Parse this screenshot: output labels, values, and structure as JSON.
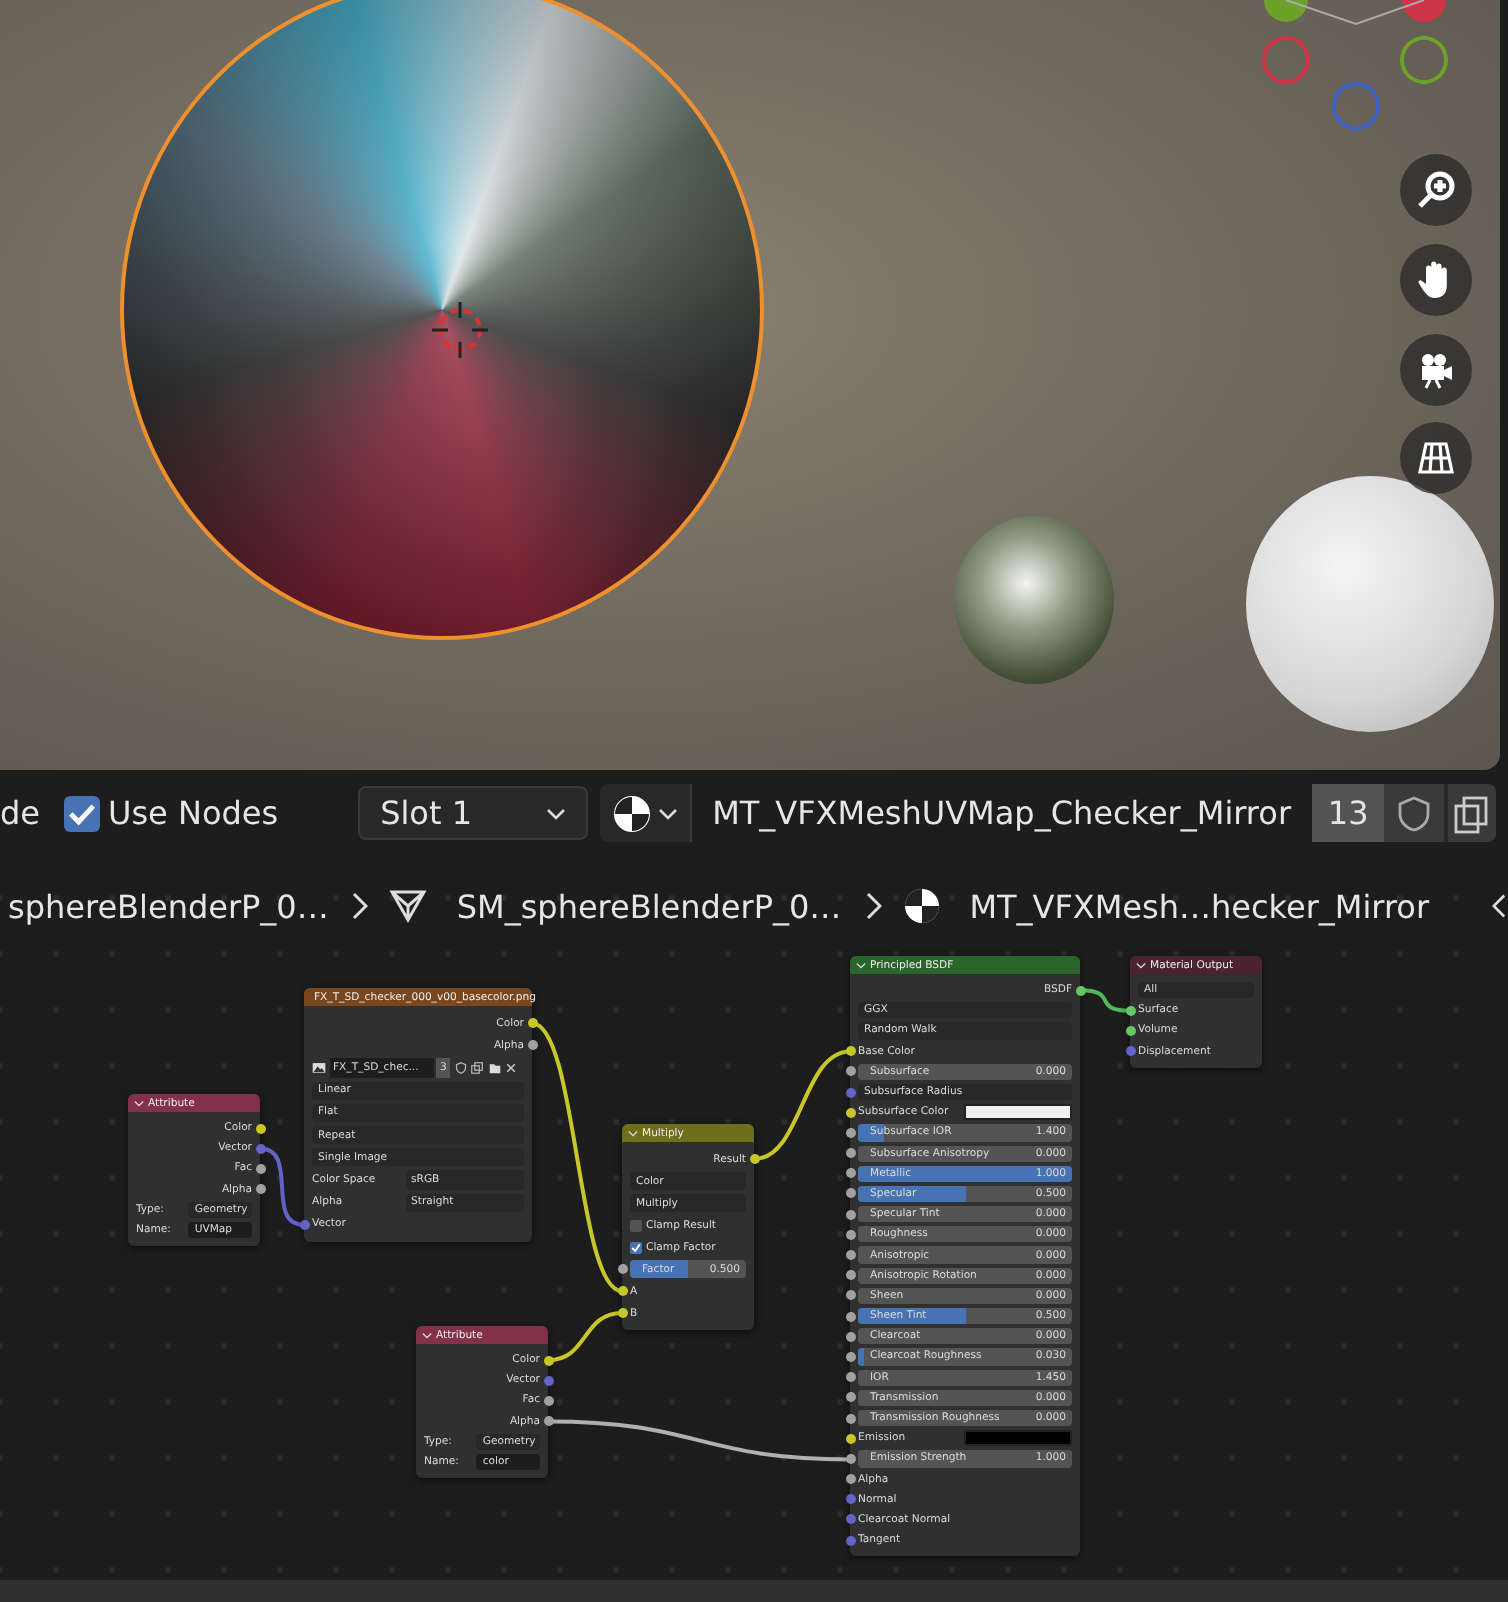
{
  "header": {
    "mode_label": "de",
    "use_nodes": {
      "label": "Use Nodes",
      "checked": true
    },
    "slot": "Slot 1",
    "material": "MT_VFXMeshUVMap_Checker_Mirror",
    "users": "13"
  },
  "breadcrumbs": [
    {
      "kind": "object",
      "label": "sphereBlenderP_0…"
    },
    {
      "kind": "mesh",
      "label": "SM_sphereBlenderP_0…"
    },
    {
      "kind": "material",
      "label": "MT_VFXMesh…hecker_Mirror"
    }
  ],
  "nodes": [
    {
      "kind": "input",
      "title": "Attribute",
      "rows": [
        {
          "kind": "output",
          "label": "Color",
          "socket": {
            "color": "#c7c729"
          }
        },
        {
          "kind": "output",
          "label": "Vector",
          "socket": {
            "color": "#6363c7"
          }
        },
        {
          "kind": "output",
          "label": "Fac",
          "socket": {
            "color": "#a1a1a1"
          }
        },
        {
          "kind": "output",
          "label": "Alpha",
          "socket": {
            "color": "#a1a1a1"
          }
        },
        {
          "kind": "labeled_dropdown",
          "label": "Type:",
          "value": "Geometry"
        },
        {
          "kind": "text_field",
          "label": "Name:",
          "value": "UVMap"
        }
      ]
    },
    {
      "kind": "texture",
      "title": "FX_T_SD_checker_000_v00_basecolor.png",
      "rows": [
        {
          "kind": "output",
          "label": "Color",
          "socket": {
            "color": "#c7c729"
          }
        },
        {
          "kind": "output",
          "label": "Alpha",
          "socket": {
            "color": "#a1a1a1"
          }
        },
        {
          "kind": "image_selector",
          "value": "FX_T_SD_chec...",
          "users": "3"
        },
        {
          "kind": "dropdown",
          "value": "Linear"
        },
        {
          "kind": "dropdown",
          "value": "Flat"
        },
        {
          "kind": "dropdown",
          "value": "Repeat"
        },
        {
          "kind": "dropdown",
          "value": "Single Image"
        },
        {
          "kind": "labeled_dropdown",
          "label": "Color Space",
          "value": "sRGB"
        },
        {
          "kind": "labeled_dropdown",
          "label": "Alpha",
          "value": "Straight"
        },
        {
          "kind": "input",
          "label": "Vector",
          "socket": {
            "color": "#6363c7"
          }
        }
      ]
    },
    {
      "kind": "color",
      "title": "Multiply",
      "rows": [
        {
          "kind": "output",
          "label": "Result",
          "socket": {
            "color": "#c7c729"
          }
        },
        {
          "kind": "dropdown",
          "value": "Color"
        },
        {
          "kind": "dropdown",
          "value": "Multiply"
        },
        {
          "kind": "checkbox",
          "label": "Clamp Result",
          "checked": false
        },
        {
          "kind": "checkbox",
          "label": "Clamp Factor",
          "checked": true
        },
        {
          "kind": "slider",
          "label": "Factor",
          "value": "0.500",
          "level": 0.5,
          "socket": {
            "color": "#a1a1a1"
          }
        },
        {
          "kind": "input",
          "label": "A",
          "socket": {
            "color": "#c7c729"
          }
        },
        {
          "kind": "input",
          "label": "B",
          "socket": {
            "color": "#c7c729"
          }
        }
      ]
    },
    {
      "kind": "input",
      "title": "Attribute",
      "rows": [
        {
          "kind": "output",
          "label": "Color",
          "socket": {
            "color": "#c7c729"
          }
        },
        {
          "kind": "output",
          "label": "Vector",
          "socket": {
            "color": "#6363c7"
          }
        },
        {
          "kind": "output",
          "label": "Fac",
          "socket": {
            "color": "#a1a1a1"
          }
        },
        {
          "kind": "output",
          "label": "Alpha",
          "socket": {
            "color": "#a1a1a1"
          }
        },
        {
          "kind": "labeled_dropdown",
          "label": "Type:",
          "value": "Geometry"
        },
        {
          "kind": "text_field",
          "label": "Name:",
          "value": "color"
        }
      ]
    },
    {
      "kind": "shader",
      "title": "Principled BSDF",
      "rows": [
        {
          "kind": "output",
          "label": "BSDF",
          "socket": {
            "color": "#63c763"
          }
        },
        {
          "kind": "dropdown",
          "value": "GGX"
        },
        {
          "kind": "dropdown",
          "value": "Random Walk"
        },
        {
          "kind": "input",
          "label": "Base Color",
          "socket": {
            "color": "#c7c729"
          }
        },
        {
          "kind": "slider",
          "label": "Subsurface",
          "value": "0.000",
          "level": 0,
          "socket": {
            "color": "#a1a1a1"
          }
        },
        {
          "kind": "dropdown",
          "value": "Subsurface Radius",
          "socket": {
            "color": "#6363c7"
          }
        },
        {
          "kind": "color_field",
          "label": "Subsurface Color",
          "color": "#f0f0f0",
          "socket": {
            "color": "#c7c729"
          }
        },
        {
          "kind": "slider",
          "label": "Subsurface IOR",
          "value": "1.400",
          "level": 0.12,
          "socket": {
            "color": "#a1a1a1"
          }
        },
        {
          "kind": "slider",
          "label": "Subsurface Anisotropy",
          "value": "0.000",
          "level": 0,
          "socket": {
            "color": "#a1a1a1"
          }
        },
        {
          "kind": "slider",
          "label": "Metallic",
          "value": "1.000",
          "level": 1,
          "socket": {
            "color": "#a1a1a1"
          }
        },
        {
          "kind": "slider",
          "label": "Specular",
          "value": "0.500",
          "level": 0.5,
          "socket": {
            "color": "#a1a1a1"
          }
        },
        {
          "kind": "slider",
          "label": "Specular Tint",
          "value": "0.000",
          "level": 0,
          "socket": {
            "color": "#a1a1a1"
          }
        },
        {
          "kind": "slider",
          "label": "Roughness",
          "value": "0.000",
          "level": 0,
          "socket": {
            "color": "#a1a1a1"
          }
        },
        {
          "kind": "slider",
          "label": "Anisotropic",
          "value": "0.000",
          "level": 0,
          "socket": {
            "color": "#a1a1a1"
          }
        },
        {
          "kind": "slider",
          "label": "Anisotropic Rotation",
          "value": "0.000",
          "level": 0,
          "socket": {
            "color": "#a1a1a1"
          }
        },
        {
          "kind": "slider",
          "label": "Sheen",
          "value": "0.000",
          "level": 0,
          "socket": {
            "color": "#a1a1a1"
          }
        },
        {
          "kind": "slider",
          "label": "Sheen Tint",
          "value": "0.500",
          "level": 0.5,
          "socket": {
            "color": "#a1a1a1"
          }
        },
        {
          "kind": "slider",
          "label": "Clearcoat",
          "value": "0.000",
          "level": 0,
          "socket": {
            "color": "#a1a1a1"
          }
        },
        {
          "kind": "slider",
          "label": "Clearcoat Roughness",
          "value": "0.030",
          "level": 0.03,
          "socket": {
            "color": "#a1a1a1"
          }
        },
        {
          "kind": "slider",
          "label": "IOR",
          "value": "1.450",
          "level": 0,
          "socket": {
            "color": "#a1a1a1"
          }
        },
        {
          "kind": "slider",
          "label": "Transmission",
          "value": "0.000",
          "level": 0,
          "socket": {
            "color": "#a1a1a1"
          }
        },
        {
          "kind": "slider",
          "label": "Transmission Roughness",
          "value": "0.000",
          "level": 0,
          "socket": {
            "color": "#a1a1a1"
          }
        },
        {
          "kind": "color_field",
          "label": "Emission",
          "color": "#000000",
          "socket": {
            "color": "#c7c729"
          }
        },
        {
          "kind": "slider",
          "label": "Emission Strength",
          "value": "1.000",
          "level": 0,
          "socket": {
            "color": "#a1a1a1"
          }
        },
        {
          "kind": "input",
          "label": "Alpha",
          "socket": {
            "color": "#a1a1a1"
          }
        },
        {
          "kind": "input",
          "label": "Normal",
          "socket": {
            "color": "#6363c7"
          }
        },
        {
          "kind": "input",
          "label": "Clearcoat Normal",
          "socket": {
            "color": "#6363c7"
          }
        },
        {
          "kind": "input",
          "label": "Tangent",
          "socket": {
            "color": "#6363c7"
          }
        }
      ]
    },
    {
      "kind": "output",
      "title": "Material Output",
      "rows": [
        {
          "kind": "dropdown",
          "value": "All"
        },
        {
          "kind": "input",
          "label": "Surface",
          "socket": {
            "color": "#63c763"
          }
        },
        {
          "kind": "input",
          "label": "Volume",
          "socket": {
            "color": "#63c763"
          }
        },
        {
          "kind": "input",
          "label": "Displacement",
          "socket": {
            "color": "#6363c7"
          }
        }
      ]
    }
  ]
}
